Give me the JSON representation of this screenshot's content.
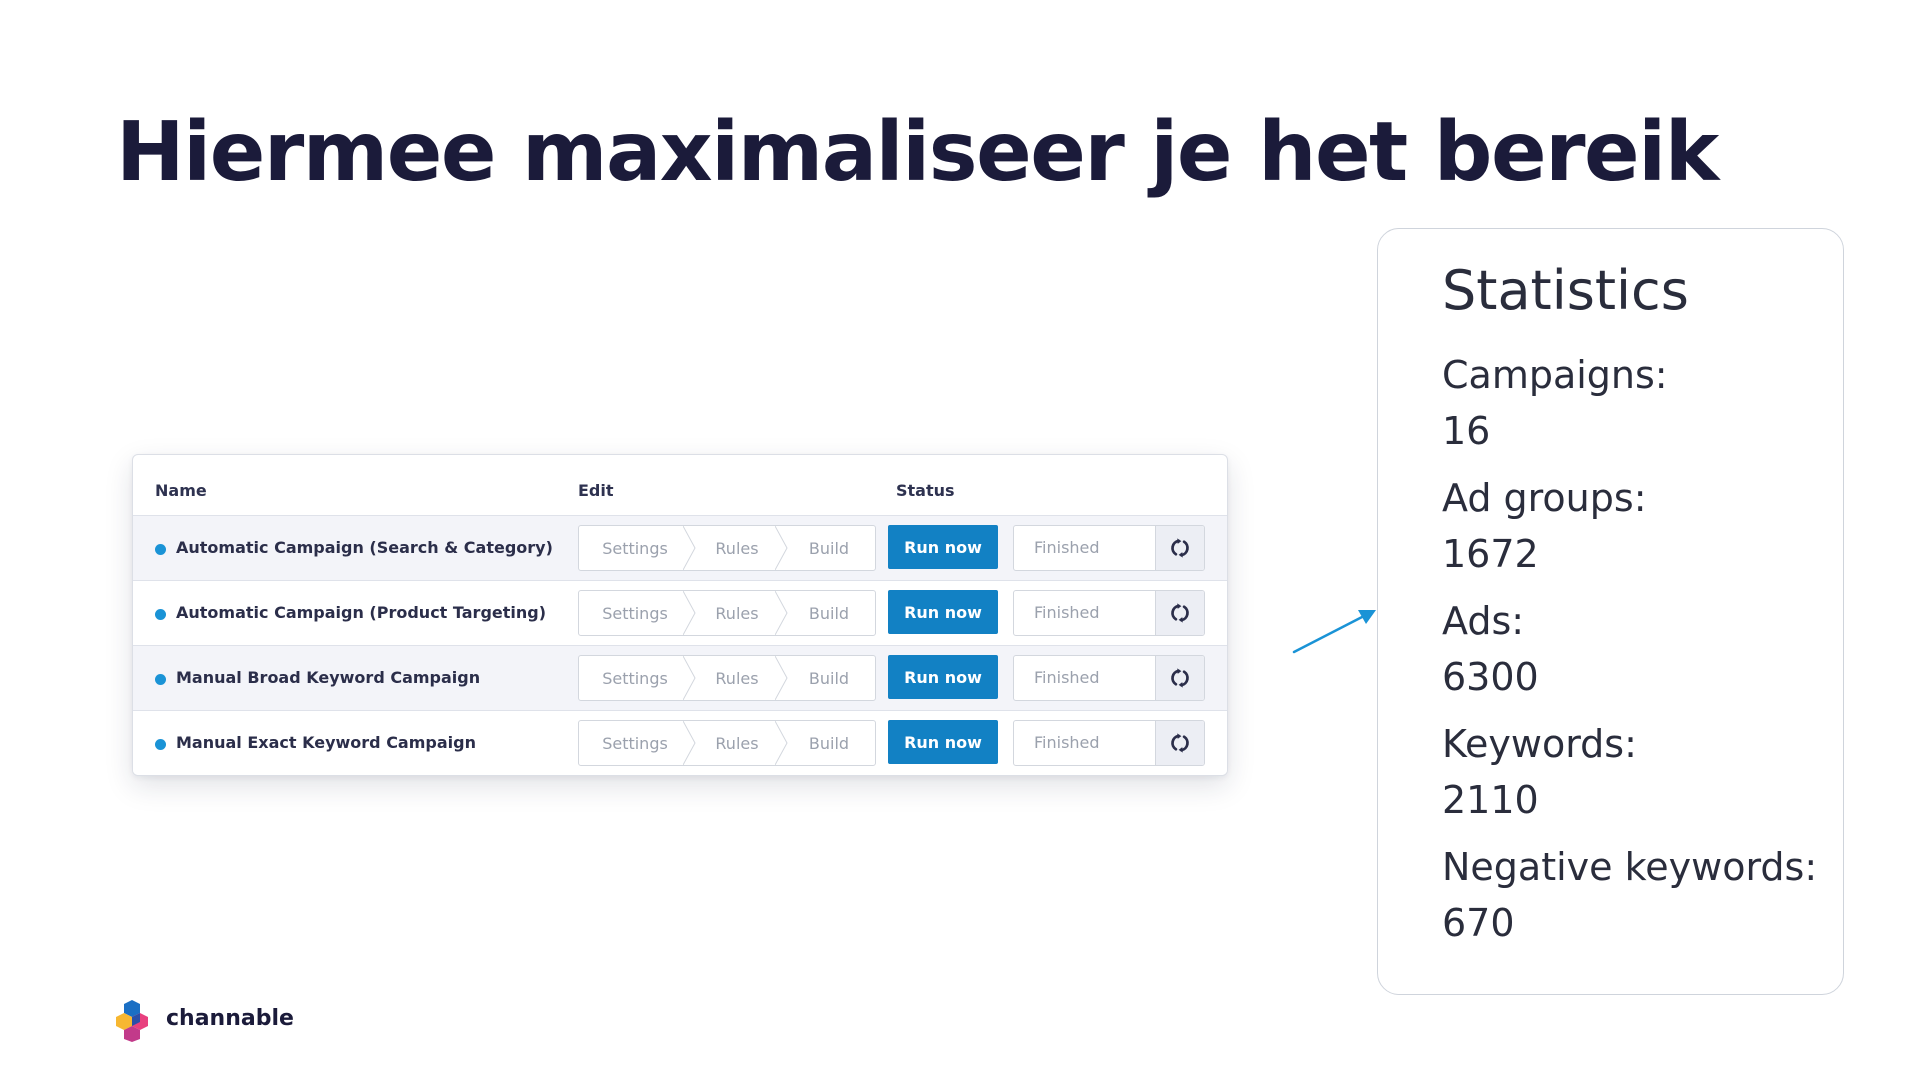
{
  "slide": {
    "title": "Hiermee maximaliseer je het bereik"
  },
  "table": {
    "headers": {
      "name": "Name",
      "edit": "Edit",
      "status": "Status"
    },
    "rows": [
      {
        "name": "Automatic Campaign (Search & Category)",
        "steps": [
          "Settings",
          "Rules",
          "Build"
        ],
        "run_label": "Run now",
        "status": "Finished"
      },
      {
        "name": "Automatic Campaign (Product Targeting)",
        "steps": [
          "Settings",
          "Rules",
          "Build"
        ],
        "run_label": "Run now",
        "status": "Finished"
      },
      {
        "name": "Manual Broad Keyword Campaign",
        "steps": [
          "Settings",
          "Rules",
          "Build"
        ],
        "run_label": "Run now",
        "status": "Finished"
      },
      {
        "name": "Manual Exact Keyword Campaign",
        "steps": [
          "Settings",
          "Rules",
          "Build"
        ],
        "run_label": "Run now",
        "status": "Finished"
      }
    ]
  },
  "statistics": {
    "title": "Statistics",
    "items": [
      {
        "label": "Campaigns:",
        "value": "16"
      },
      {
        "label": "Ad groups:",
        "value": "1672"
      },
      {
        "label": "Ads:",
        "value": "6300"
      },
      {
        "label": "Keywords:",
        "value": "2110"
      },
      {
        "label": "Negative keywords:",
        "value": "670"
      }
    ]
  },
  "brand": {
    "name": "channable"
  },
  "icons": {
    "row_dot": "status-dot-icon",
    "refresh": "refresh-icon",
    "arrow": "arrow-icon",
    "logo": "channable-logo-icon"
  },
  "colors": {
    "title": "#1b1b3a",
    "primary_button": "#1281c4",
    "status_dot": "#1a93d6",
    "arrow": "#1a93d6"
  }
}
